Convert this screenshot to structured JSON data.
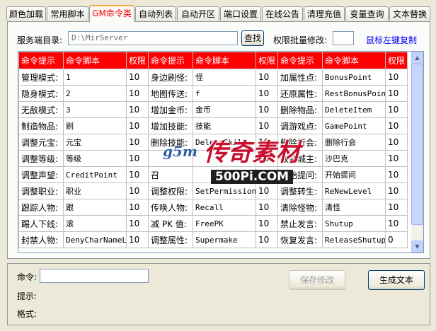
{
  "tabs": [
    {
      "label": "颜色加载"
    },
    {
      "label": "常用脚本"
    },
    {
      "label": "GM命令类"
    },
    {
      "label": "自动列表"
    },
    {
      "label": "自动开区"
    },
    {
      "label": "端口设置"
    },
    {
      "label": "在线公告"
    },
    {
      "label": "清理充值"
    },
    {
      "label": "变量查询"
    },
    {
      "label": "文本替换"
    }
  ],
  "active_tab_index": 2,
  "server": {
    "label": "服务端目录:",
    "path": "D:\\MirServer",
    "find_button": "查找",
    "batch_label": "权限批量修改:",
    "batch_value": "",
    "copy_hint": "鼠标左键复制"
  },
  "table": {
    "headers": [
      "命令提示",
      "命令脚本",
      "权限",
      "命令提示",
      "命令脚本",
      "权限",
      "命令提示",
      "命令脚本",
      "权限"
    ],
    "rows": [
      [
        "管理模式:",
        "1",
        "10",
        "身边刷怪:",
        "怪",
        "10",
        "加属性点:",
        "BonusPoint",
        "10"
      ],
      [
        "隐身模式:",
        "2",
        "10",
        "地图传送:",
        "f",
        "10",
        "还原属性:",
        "RestBonusPoint",
        "10"
      ],
      [
        "无敌模式:",
        "3",
        "10",
        "增加金币:",
        "金币",
        "10",
        "删除物品:",
        "DeleteItem",
        "10"
      ],
      [
        "制造物品:",
        "刷",
        "10",
        "增加技能:",
        "技能",
        "10",
        "调游戏点:",
        "GamePoint",
        "10"
      ],
      [
        "调整元宝:",
        "元宝",
        "10",
        "删除技能:",
        "DeleteSkill",
        "10",
        "删除行会:",
        "删除行会",
        "10"
      ],
      [
        "调整等级:",
        "等级",
        "10",
        "",
        "",
        "10",
        "改变城主:",
        "沙巴克",
        "10"
      ],
      [
        "调整声望:",
        "CreditPoint",
        "10",
        "召",
        "",
        "10",
        "开始提问:",
        "开始提问",
        "10"
      ],
      [
        "调整职业:",
        "职业",
        "10",
        "调整权限:",
        "SetPermission",
        "10",
        "调整转生:",
        "ReNewLevel",
        "10"
      ],
      [
        "跟踪人物:",
        "跟",
        "10",
        "传唤人物:",
        "Recall",
        "10",
        "清除怪物:",
        "清怪",
        "10"
      ],
      [
        "踢人下线:",
        "滚",
        "10",
        "减 PK 值:",
        "FreePK",
        "10",
        "禁止发言:",
        "Shutup",
        "10"
      ],
      [
        "封禁人物:",
        "DenyCharNameLogon",
        "10",
        "调整属性:",
        "Supermake",
        "10",
        "恢复发言:",
        "ReleaseShutup",
        "0"
      ]
    ],
    "scroll_fraction": 0.0
  },
  "bottom": {
    "command_label": "命令:",
    "command_value": "",
    "save_button": "保存修改",
    "generate_button": "生成文本",
    "hint_label": "提示:",
    "format_label": "格式:"
  },
  "watermark": {
    "main": "传奇素材",
    "url": "500Pi.COM",
    "logo": "g5m"
  },
  "colors": {
    "header_bg": "#ff0000",
    "active_tab_text": "#ff0000",
    "link": "#0000ff"
  }
}
